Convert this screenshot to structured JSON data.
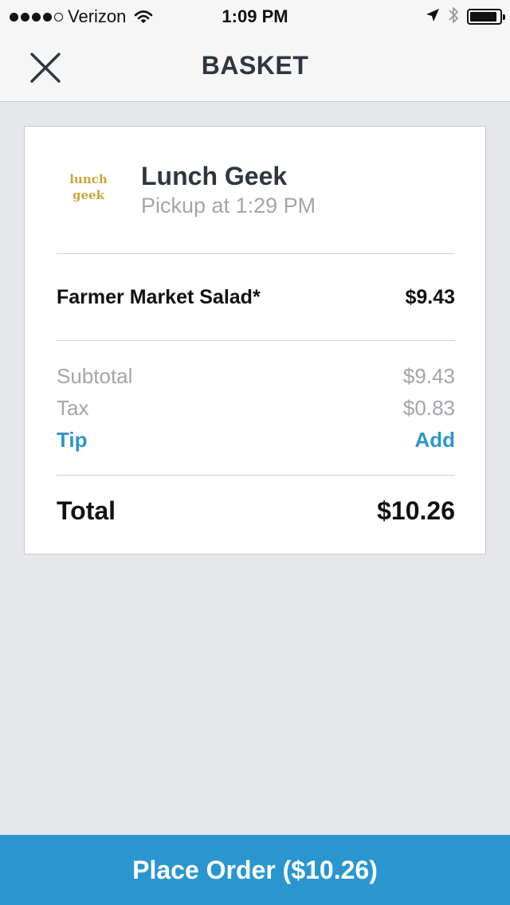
{
  "status_bar": {
    "carrier": "Verizon",
    "time": "1:09 PM"
  },
  "nav": {
    "title": "BASKET"
  },
  "restaurant": {
    "logo_line1": "lunch",
    "logo_line2": "geek",
    "name": "Lunch Geek",
    "pickup": "Pickup at 1:29 PM"
  },
  "items": [
    {
      "name": "Farmer Market Salad*",
      "price": "$9.43"
    }
  ],
  "summary": {
    "subtotal_label": "Subtotal",
    "subtotal_value": "$9.43",
    "tax_label": "Tax",
    "tax_value": "$0.83",
    "tip_label": "Tip",
    "tip_action": "Add",
    "total_label": "Total",
    "total_value": "$10.26"
  },
  "actions": {
    "place_order_label": "Place Order ($10.26)"
  },
  "colors": {
    "accent": "#2a96cf",
    "title_text": "#2e3640",
    "muted_text": "#a2a5aa",
    "background": "#e6e7ea",
    "logo": "#c8a63a"
  },
  "icons": {
    "signal": "signal-dots-icon",
    "wifi": "wifi-icon",
    "location": "location-arrow-icon",
    "bluetooth": "bluetooth-icon",
    "battery": "battery-icon",
    "close": "close-icon"
  }
}
